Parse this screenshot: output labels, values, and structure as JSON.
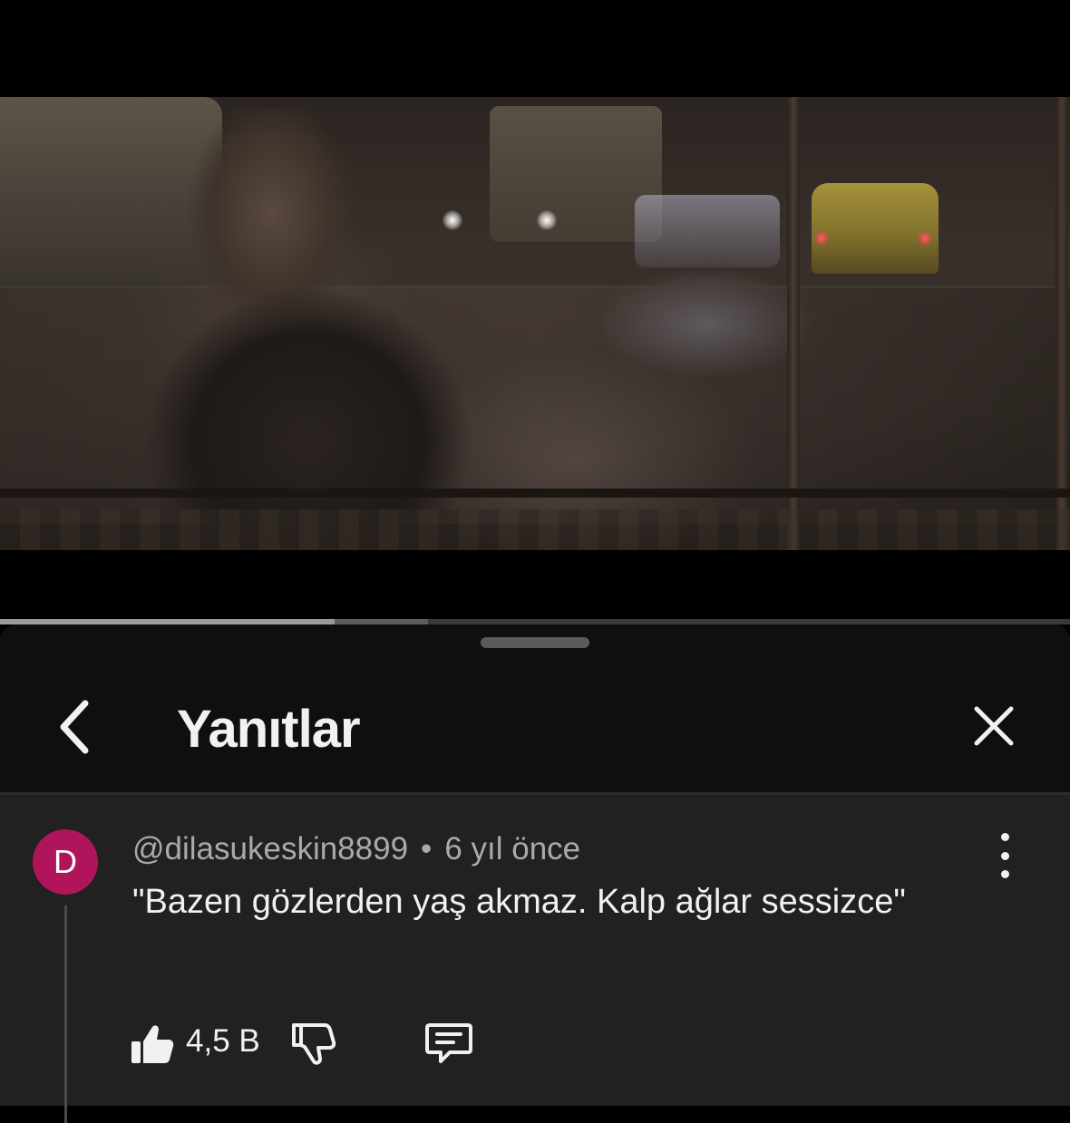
{
  "player": {
    "progress_played": 0.313,
    "progress_buffered": 0.4
  },
  "sheet": {
    "title": "Yanıtlar",
    "back_icon": "chevron-left-icon",
    "close_icon": "close-icon"
  },
  "comment": {
    "avatar_letter": "D",
    "avatar_color": "#b0155c",
    "author": "@dilasukeskin8899",
    "separator": "•",
    "time": "6 yıl önce",
    "text": "\"Bazen gözlerden yaş akmaz. Kalp ağlar sessizce\"",
    "like_count": "4,5 B",
    "icons": {
      "like": "thumbs-up-filled-icon",
      "dislike": "thumbs-down-icon",
      "reply": "comment-reply-icon",
      "more": "more-vertical-icon"
    }
  },
  "colors": {
    "sheet_background": "#212121",
    "header_background": "#0f0f0f",
    "secondary_text": "#aaaaaa"
  }
}
